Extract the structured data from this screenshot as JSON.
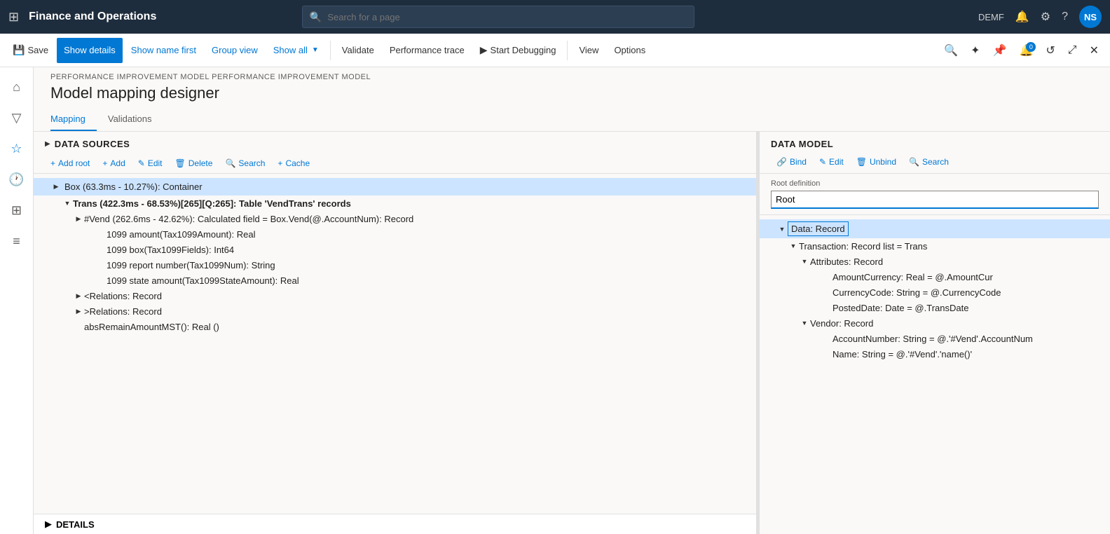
{
  "topNav": {
    "appTitle": "Finance and Operations",
    "searchPlaceholder": "Search for a page",
    "userLabel": "DEMF",
    "userInitials": "NS"
  },
  "toolbar": {
    "saveLabel": "Save",
    "showDetailsLabel": "Show details",
    "showNameFirstLabel": "Show name first",
    "groupViewLabel": "Group view",
    "showAllLabel": "Show all",
    "validateLabel": "Validate",
    "performanceTraceLabel": "Performance trace",
    "startDebuggingLabel": "Start Debugging",
    "viewLabel": "View",
    "optionsLabel": "Options"
  },
  "breadcrumb": "PERFORMANCE IMPROVEMENT MODEL PERFORMANCE IMPROVEMENT MODEL",
  "pageTitle": "Model mapping designer",
  "tabs": [
    {
      "label": "Mapping",
      "active": true
    },
    {
      "label": "Validations",
      "active": false
    }
  ],
  "dataSourcesPanel": {
    "title": "DATA SOURCES",
    "buttons": [
      {
        "label": "Add root",
        "icon": "+"
      },
      {
        "label": "Add",
        "icon": "+"
      },
      {
        "label": "Edit",
        "icon": "✎"
      },
      {
        "label": "Delete",
        "icon": "🗑"
      },
      {
        "label": "Search",
        "icon": "🔍"
      },
      {
        "label": "Cache",
        "icon": "+"
      }
    ],
    "tree": [
      {
        "id": 1,
        "indent": 0,
        "expanded": true,
        "selected": true,
        "label": "Box (63.3ms - 10.27%): Container",
        "hasExpand": true
      },
      {
        "id": 2,
        "indent": 1,
        "expanded": true,
        "selected": false,
        "label": "Trans (422.3ms - 68.53%)[265][Q:265]: Table 'VendTrans' records",
        "hasExpand": true
      },
      {
        "id": 3,
        "indent": 2,
        "expanded": false,
        "selected": false,
        "label": "#Vend (262.6ms - 42.62%): Calculated field = Box.Vend(@.AccountNum): Record",
        "hasExpand": true
      },
      {
        "id": 4,
        "indent": 3,
        "expanded": false,
        "selected": false,
        "label": "1099 amount(Tax1099Amount): Real",
        "hasExpand": false
      },
      {
        "id": 5,
        "indent": 3,
        "expanded": false,
        "selected": false,
        "label": "1099 box(Tax1099Fields): Int64",
        "hasExpand": false
      },
      {
        "id": 6,
        "indent": 3,
        "expanded": false,
        "selected": false,
        "label": "1099 report number(Tax1099Num): String",
        "hasExpand": false
      },
      {
        "id": 7,
        "indent": 3,
        "expanded": false,
        "selected": false,
        "label": "1099 state amount(Tax1099StateAmount): Real",
        "hasExpand": false
      },
      {
        "id": 8,
        "indent": 2,
        "expanded": false,
        "selected": false,
        "label": "<Relations: Record",
        "hasExpand": true
      },
      {
        "id": 9,
        "indent": 2,
        "expanded": false,
        "selected": false,
        "label": ">Relations: Record",
        "hasExpand": true
      },
      {
        "id": 10,
        "indent": 2,
        "expanded": false,
        "selected": false,
        "label": "absRemainAmountMST(): Real ()",
        "hasExpand": false
      }
    ]
  },
  "dataModelPanel": {
    "title": "DATA MODEL",
    "buttons": [
      {
        "label": "Bind",
        "icon": "🔗"
      },
      {
        "label": "Edit",
        "icon": "✎"
      },
      {
        "label": "Unbind",
        "icon": "🗑"
      },
      {
        "label": "Search",
        "icon": "🔍"
      }
    ],
    "rootDefinitionLabel": "Root definition",
    "rootDefinitionValue": "Root",
    "tree": [
      {
        "id": 1,
        "indent": 0,
        "expanded": true,
        "selected": true,
        "label": "Data: Record",
        "hasExpand": true
      },
      {
        "id": 2,
        "indent": 1,
        "expanded": true,
        "selected": false,
        "label": "Transaction: Record list = Trans",
        "hasExpand": true
      },
      {
        "id": 3,
        "indent": 2,
        "expanded": true,
        "selected": false,
        "label": "Attributes: Record",
        "hasExpand": true
      },
      {
        "id": 4,
        "indent": 3,
        "expanded": false,
        "selected": false,
        "label": "AmountCurrency: Real = @.AmountCur",
        "hasExpand": false
      },
      {
        "id": 5,
        "indent": 3,
        "expanded": false,
        "selected": false,
        "label": "CurrencyCode: String = @.CurrencyCode",
        "hasExpand": false
      },
      {
        "id": 6,
        "indent": 3,
        "expanded": false,
        "selected": false,
        "label": "PostedDate: Date = @.TransDate",
        "hasExpand": false
      },
      {
        "id": 7,
        "indent": 2,
        "expanded": true,
        "selected": false,
        "label": "Vendor: Record",
        "hasExpand": true
      },
      {
        "id": 8,
        "indent": 3,
        "expanded": false,
        "selected": false,
        "label": "AccountNumber: String = @.'#Vend'.AccountNum",
        "hasExpand": false
      },
      {
        "id": 9,
        "indent": 3,
        "expanded": false,
        "selected": false,
        "label": "Name: String = @.'#Vend'.'name()'",
        "hasExpand": false
      }
    ]
  },
  "detailsPanel": {
    "label": "DETAILS"
  }
}
